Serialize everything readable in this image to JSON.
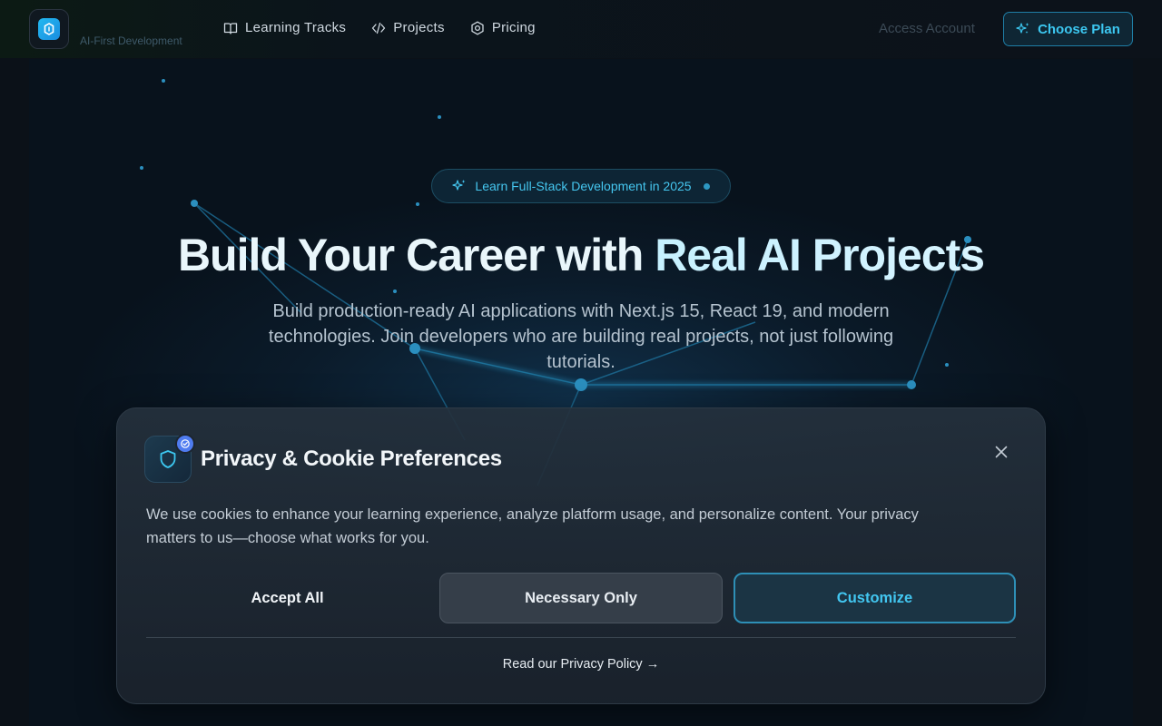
{
  "brand": {
    "subtitle": "AI-First Development"
  },
  "nav": {
    "links": [
      {
        "label": "Learning Tracks",
        "icon": "book-icon"
      },
      {
        "label": "Projects",
        "icon": "code-icon"
      },
      {
        "label": "Pricing",
        "icon": "hexagon-icon"
      }
    ],
    "access_label": "Access Account",
    "cta_label": "Choose Plan"
  },
  "hero": {
    "badge": "Learn Full-Stack Development in 2025",
    "title_part1": "Build Your Career with ",
    "title_part2": "Real AI Projects",
    "subtitle": "Build production-ready AI applications with Next.js 15, React 19, and modern technologies. Join developers who are building real projects, not just following tutorials."
  },
  "cookie": {
    "title": "Privacy & Cookie Preferences",
    "text": "We use cookies to enhance your learning experience, analyze platform usage, and personalize content. Your privacy matters to us—choose what works for you.",
    "accept_label": "Accept All",
    "necessary_label": "Necessary Only",
    "customize_label": "Customize",
    "policy_link": "Read our Privacy Policy →"
  },
  "colors": {
    "accent": "#3cc7f0",
    "background": "#0b1118",
    "card": "#1f2935"
  }
}
